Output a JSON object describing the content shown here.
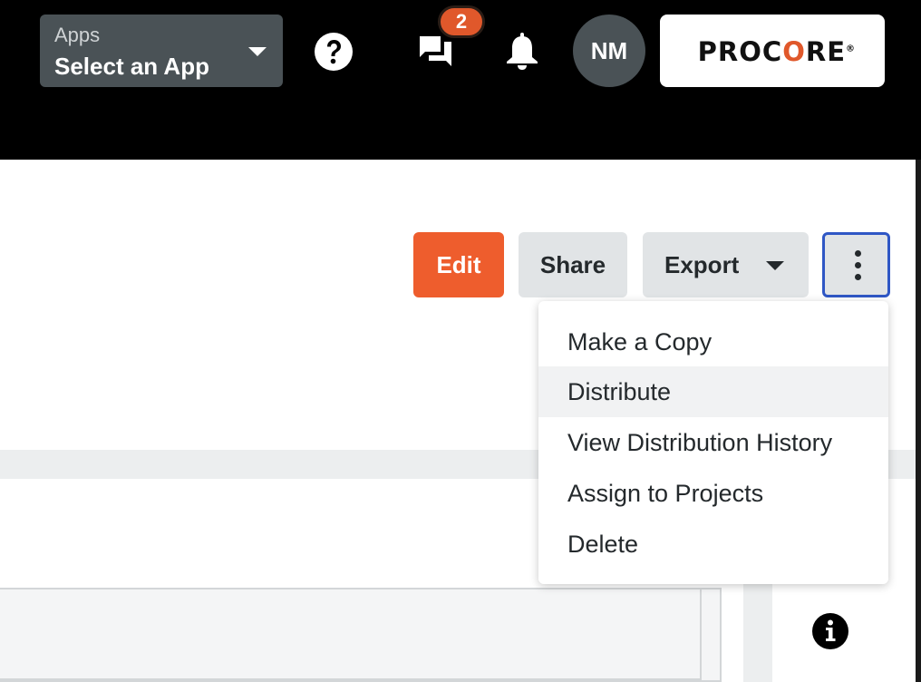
{
  "topbar": {
    "apps_label": "Apps",
    "apps_value": "Select an App",
    "messages_badge": "2",
    "user_initials": "NM",
    "logo_text_pre": "PROC",
    "logo_text_o": "O",
    "logo_text_post": "RE",
    "logo_mark": "®"
  },
  "toolbar": {
    "edit_label": "Edit",
    "share_label": "Share",
    "export_label": "Export"
  },
  "more_menu": {
    "items": [
      {
        "label": "Make a Copy"
      },
      {
        "label": "Distribute"
      },
      {
        "label": "View Distribution History"
      },
      {
        "label": "Assign to Projects"
      },
      {
        "label": "Delete"
      }
    ]
  },
  "icons": {
    "help": "help-circle-icon",
    "messages": "chat-bubbles-icon",
    "notifications": "bell-icon",
    "more": "more-vertical-icon",
    "info": "info-circle-icon"
  },
  "colors": {
    "accent": "#ee5d2d",
    "badge": "#e0582b",
    "focus_ring": "#2f57c5",
    "topbar": "#000000"
  }
}
